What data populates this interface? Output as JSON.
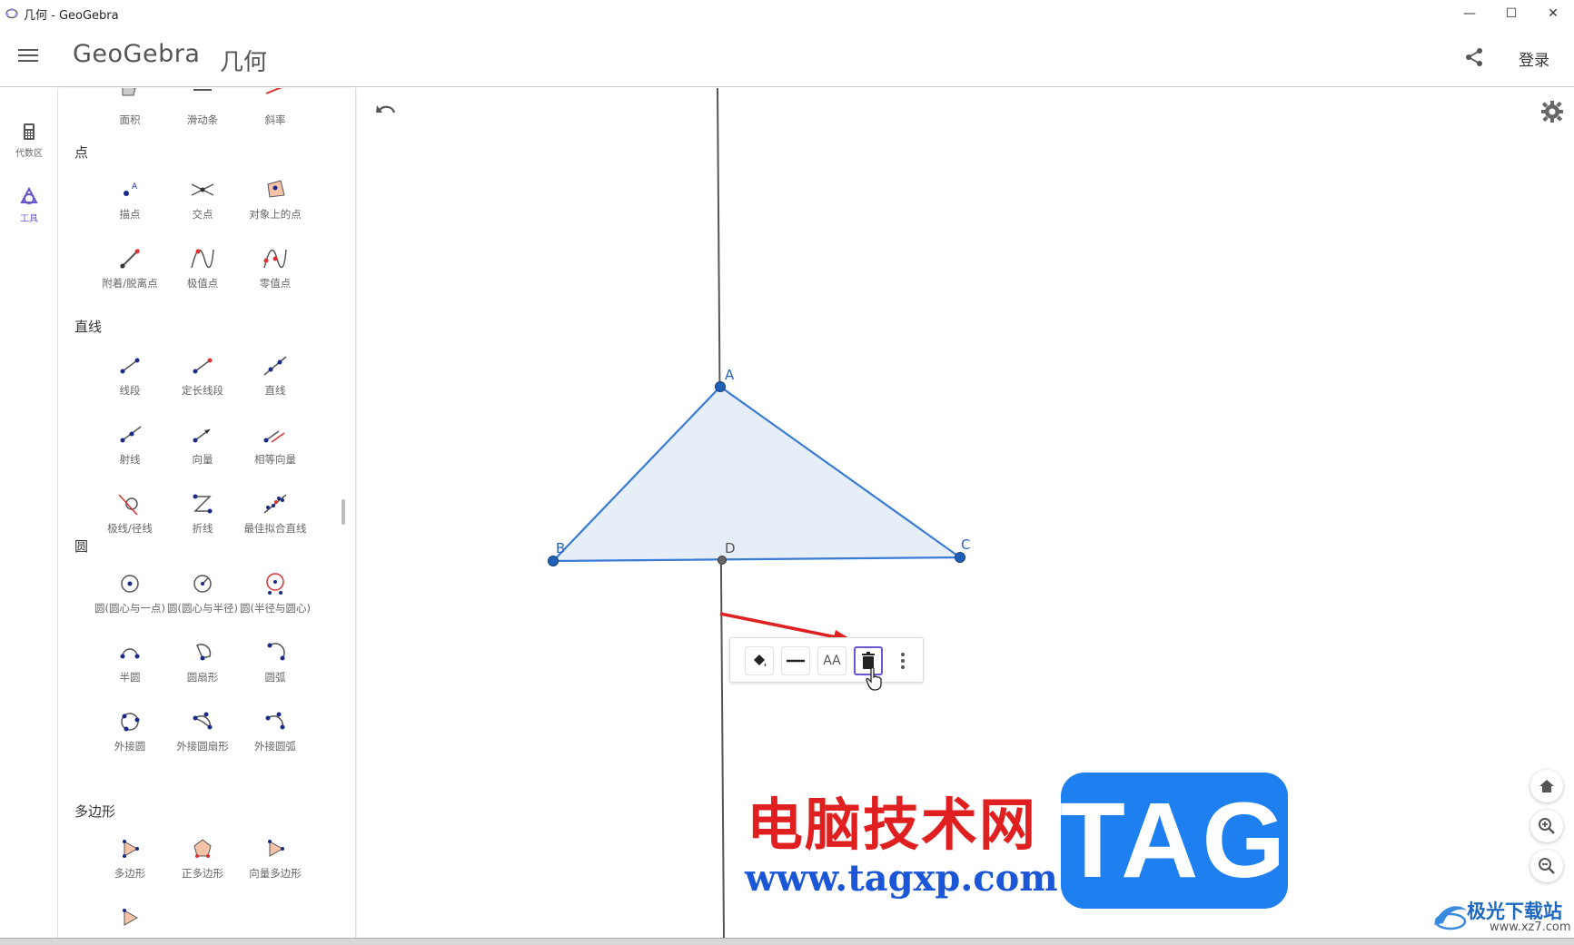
{
  "window": {
    "title": "几何 - GeoGebra",
    "minimize": "—",
    "maximize": "☐",
    "close": "✕"
  },
  "appbar": {
    "logo": "GeoGebra",
    "subtitle": "几何",
    "login": "登录"
  },
  "siderail": {
    "items": [
      {
        "label": "代数区"
      },
      {
        "label": "工具"
      }
    ]
  },
  "toolpanel": {
    "top_tools": [
      "面积",
      "滑动条",
      "斜率"
    ],
    "sections": [
      {
        "title": "点",
        "tools": [
          "描点",
          "交点",
          "对象上的点",
          "附着/脱离点",
          "极值点",
          "零值点"
        ]
      },
      {
        "title": "直线",
        "tools": [
          "线段",
          "定长线段",
          "直线",
          "射线",
          "向量",
          "相等向量",
          "极线/径线",
          "折线",
          "最佳拟合直线"
        ]
      },
      {
        "title": "圆",
        "tools": [
          "圆(圆心与一点)",
          "圆(圆心与半径)",
          "圆(半径与圆心)",
          "半圆",
          "圆扇形",
          "圆弧",
          "外接圆",
          "外接圆扇形",
          "外接圆弧"
        ]
      },
      {
        "title": "多边形",
        "tools": [
          "多边形",
          "正多边形",
          "向量多边形"
        ]
      }
    ]
  },
  "geometry": {
    "points": [
      "A",
      "B",
      "C",
      "D"
    ],
    "accent": "#3a7bd5",
    "fill": "#e6eef8"
  },
  "stylebar": {
    "font_btn": "AA"
  },
  "watermark": {
    "site_cn": "电脑技术网",
    "url": "www.tagxp.com",
    "tag": "TAG",
    "corner_cn": "极光下载站",
    "corner_url": "www.xz7.com"
  },
  "colors": {
    "accent_purple": "#6557d2",
    "arrow_red": "#e02020"
  }
}
